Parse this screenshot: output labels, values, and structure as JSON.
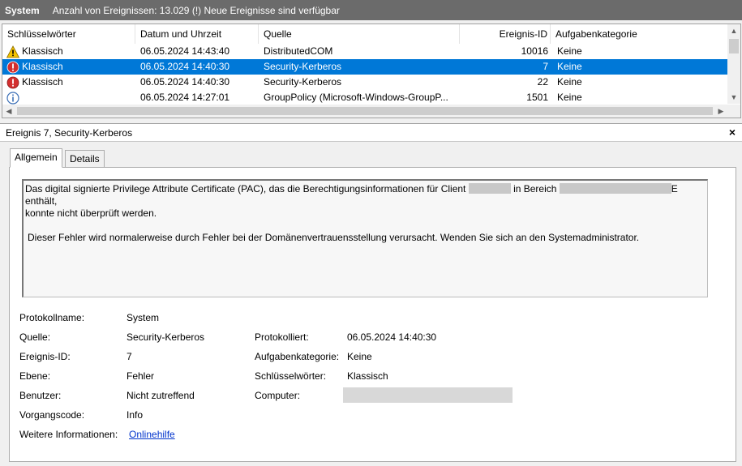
{
  "titlebar": {
    "log_name": "System",
    "summary": "Anzahl von Ereignissen: 13.029 (!) Neue Ereignisse sind verfügbar"
  },
  "columns": [
    "Schlüsselwörter",
    "Datum und Uhrzeit",
    "Quelle",
    "Ereignis-ID",
    "Aufgabenkategorie"
  ],
  "events": [
    {
      "level": "Warnung",
      "keywords": "Klassisch",
      "datetime": "06.05.2024 14:43:40",
      "source": "DistributedCOM",
      "id": "10016",
      "category": "Keine",
      "selected": false
    },
    {
      "level": "Fehler",
      "keywords": "Klassisch",
      "datetime": "06.05.2024 14:40:30",
      "source": "Security-Kerberos",
      "id": "7",
      "category": "Keine",
      "selected": true
    },
    {
      "level": "Fehler",
      "keywords": "Klassisch",
      "datetime": "06.05.2024 14:40:30",
      "source": "Security-Kerberos",
      "id": "22",
      "category": "Keine",
      "selected": false
    },
    {
      "level": "Informationen",
      "keywords": "",
      "datetime": "06.05.2024 14:27:01",
      "source": "GroupPolicy (Microsoft-Windows-GroupP...",
      "id": "1501",
      "category": "Keine",
      "selected": false
    }
  ],
  "detail": {
    "title": "Ereignis 7, Security-Kerberos",
    "close": "×",
    "tabs": [
      "Allgemein",
      "Details"
    ],
    "message": {
      "part1": "Das digital signierte Privilege Attribute Certificate (PAC), das die Berechtigungsinformationen für Client",
      "part2": "in Bereich",
      "part3": "E enthält,",
      "line2": "konnte nicht überprüft werden.",
      "para2": "Dieser Fehler wird normalerweise durch Fehler bei der Domänenvertrauensstellung verursacht. Wenden Sie sich an den Systemadministrator."
    },
    "fields": {
      "log_label": "Protokollname:",
      "log_value": "System",
      "source_label": "Quelle:",
      "source_value": "Security-Kerberos",
      "logged_label": "Protokolliert:",
      "logged_value": "06.05.2024 14:40:30",
      "id_label": "Ereignis-ID:",
      "id_value": "7",
      "task_label": "Aufgabenkategorie:",
      "task_value": "Keine",
      "level_label": "Ebene:",
      "level_value": "Fehler",
      "keywords_label": "Schlüsselwörter:",
      "keywords_value": "Klassisch",
      "user_label": "Benutzer:",
      "user_value": "Nicht zutreffend",
      "computer_label": "Computer:",
      "opcode_label": "Vorgangscode:",
      "opcode_value": "Info",
      "more_label": "Weitere Informationen:",
      "more_link": "Onlinehilfe"
    }
  },
  "colors": {
    "titlebar": "#6b6b6b",
    "selection": "#0078d7",
    "link": "#0033cc",
    "error": "#d32f2f",
    "warning": "#f5c400"
  }
}
